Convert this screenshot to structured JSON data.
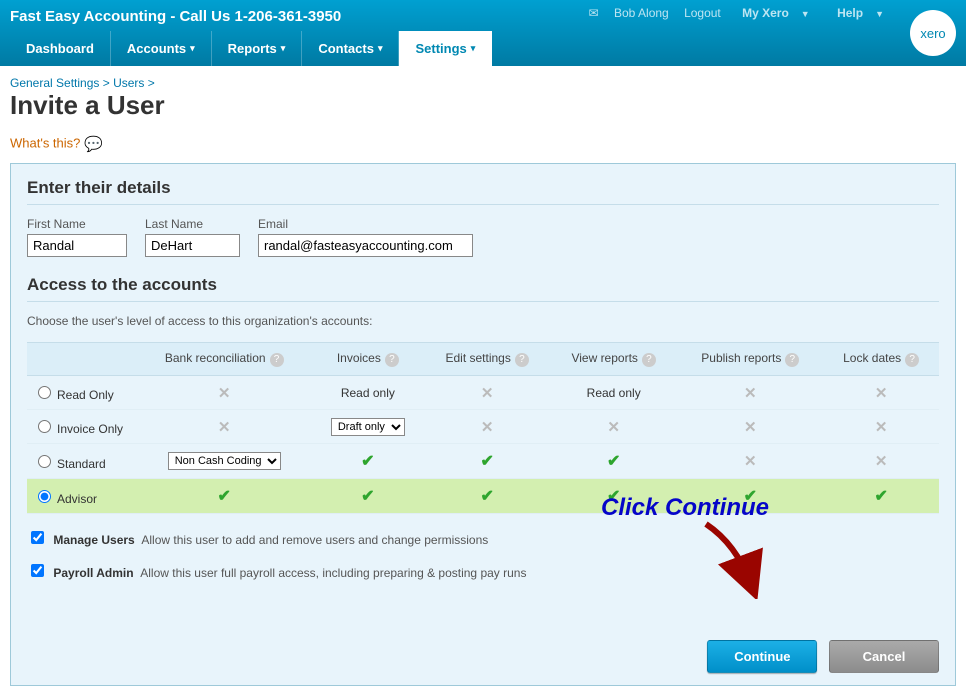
{
  "header": {
    "org_title": "Fast Easy Accounting - Call Us 1-206-361-3950",
    "user_name": "Bob Along",
    "logout": "Logout",
    "myxero": "My Xero",
    "help": "Help",
    "logo": "xero",
    "tabs": {
      "dashboard": "Dashboard",
      "accounts": "Accounts",
      "reports": "Reports",
      "contacts": "Contacts",
      "settings": "Settings"
    }
  },
  "breadcrumb": {
    "a": "General Settings",
    "b": "Users",
    "sep": " > "
  },
  "page_title": "Invite a User",
  "whats_this": "What's this?",
  "details": {
    "heading": "Enter their details",
    "first_label": "First Name",
    "last_label": "Last Name",
    "email_label": "Email",
    "first_value": "Randal",
    "last_value": "DeHart",
    "email_value": "randal@fasteasyaccounting.com"
  },
  "access": {
    "heading": "Access to the accounts",
    "desc": "Choose the user's level of access to this organization's accounts:",
    "cols": {
      "bank": "Bank reconciliation",
      "inv": "Invoices",
      "edit": "Edit settings",
      "view": "View reports",
      "pub": "Publish reports",
      "lock": "Lock dates"
    },
    "roles": {
      "readonly": {
        "label": "Read Only",
        "inv_text": "Read only",
        "view_text": "Read only"
      },
      "invoice": {
        "label": "Invoice Only",
        "inv_select": "Draft only"
      },
      "standard": {
        "label": "Standard",
        "bank_select": "Non Cash Coding"
      },
      "advisor": {
        "label": "Advisor"
      }
    },
    "selected_role": "advisor",
    "manage_users": {
      "checked": true,
      "label": "Manage Users",
      "desc": "Allow this user to add and remove users and change permissions"
    },
    "payroll_admin": {
      "checked": true,
      "label": "Payroll Admin",
      "desc": "Allow this user full payroll access, including preparing & posting pay runs"
    }
  },
  "annotation": "Click Continue",
  "buttons": {
    "continue": "Continue",
    "cancel": "Cancel"
  }
}
